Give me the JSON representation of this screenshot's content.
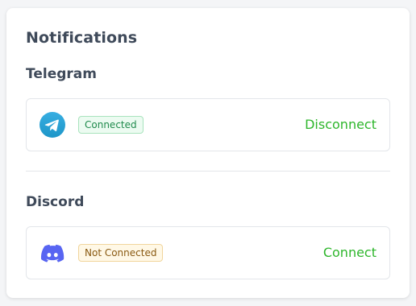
{
  "panel": {
    "title": "Notifications"
  },
  "telegram": {
    "heading": "Telegram",
    "icon": "telegram-icon",
    "status": "Connected",
    "action_label": "Disconnect"
  },
  "discord": {
    "heading": "Discord",
    "icon": "discord-icon",
    "status": "Not Connected",
    "action_label": "Connect"
  },
  "colors": {
    "action_green": "#2eb62c",
    "telegram_blue": "#2aa3e0",
    "discord_blurple": "#5865f2",
    "heading_text": "#3f4a5a"
  }
}
